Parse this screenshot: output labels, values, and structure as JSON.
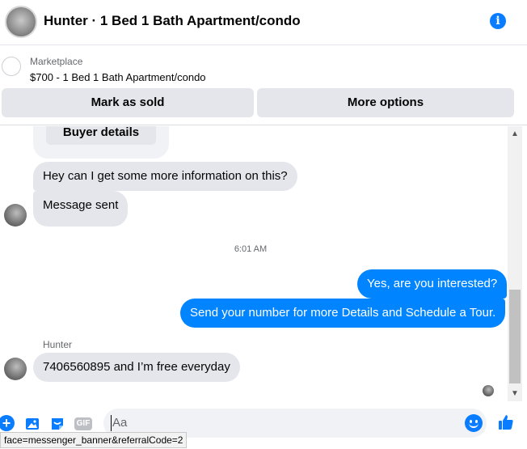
{
  "header": {
    "title": "Hunter · 1 Bed 1 Bath Apartment/condo",
    "info_icon": "info-icon"
  },
  "marketplace": {
    "label": "Marketplace",
    "listing": "$700 - 1 Bed 1 Bath Apartment/condo",
    "mark_sold_label": "Mark as sold",
    "more_options_label": "More options"
  },
  "thread": {
    "buyer_details_label": "Buyer details",
    "timestamp": "6:01 AM",
    "sender_name": "Hunter",
    "messages": [
      {
        "text": "Hey can I get some more information on this?",
        "direction": "incoming"
      },
      {
        "text": "Message sent",
        "direction": "incoming"
      },
      {
        "text": "Yes, are you interested?",
        "direction": "outgoing"
      },
      {
        "text": "Send your number for more Details and Schedule a Tour.",
        "direction": "outgoing"
      },
      {
        "text": "7406560895 and I’m free everyday",
        "direction": "incoming"
      }
    ]
  },
  "composer": {
    "placeholder": "Aa",
    "gif_label": "GIF",
    "icons": [
      "plus-icon",
      "photo-icon",
      "sticker-icon",
      "gif-icon",
      "emoji-icon",
      "like-icon"
    ]
  },
  "status_bar": {
    "url_text": "face=messenger_banner&referralCode=2"
  },
  "colors": {
    "accent": "#0084ff",
    "incoming_bubble": "#e4e6eb",
    "secondary_text": "#65676b"
  }
}
